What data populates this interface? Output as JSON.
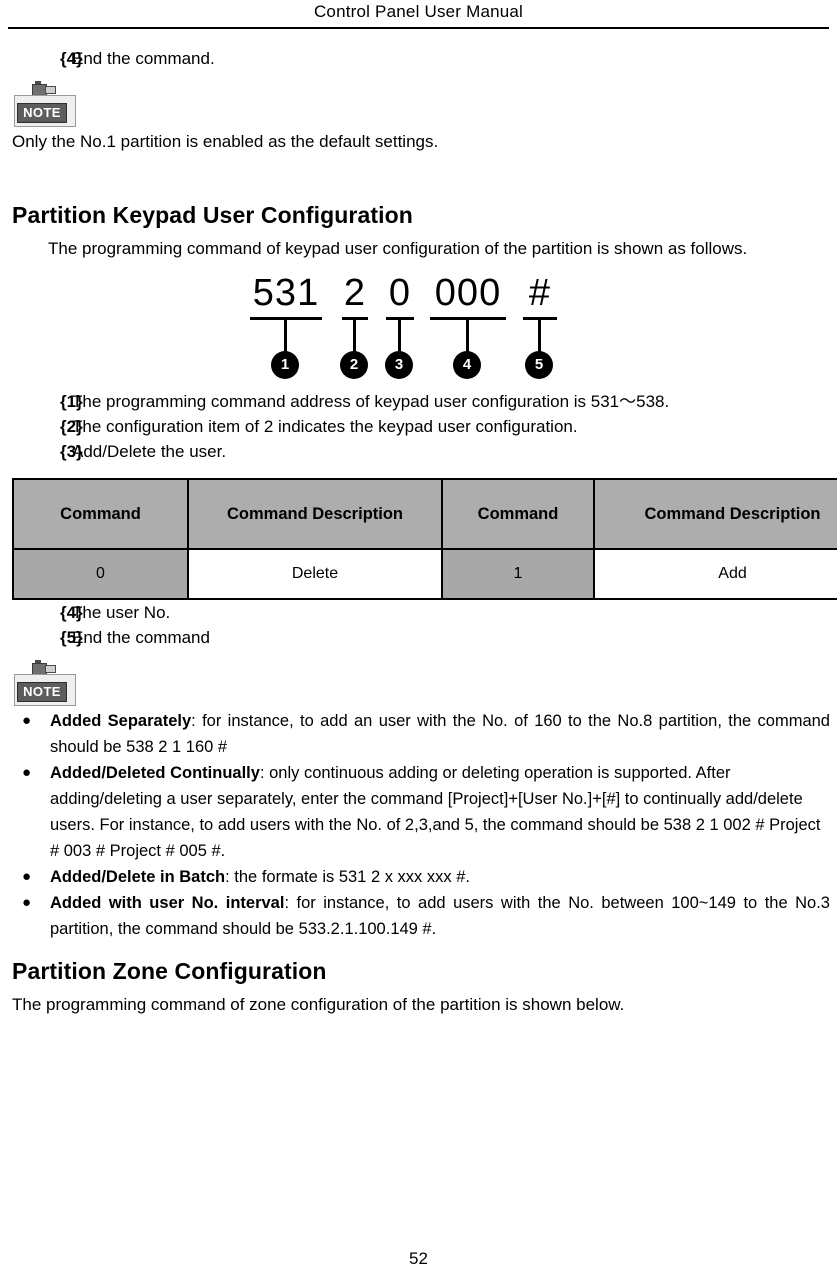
{
  "header": {
    "title": "Control Panel User Manual"
  },
  "footer": {
    "page_number": "52"
  },
  "note_icon": {
    "label": "NOTE"
  },
  "top_section": {
    "item4": {
      "mark": "{4}",
      "text": "End the command."
    },
    "note_text": "Only the No.1 partition is enabled as the default settings."
  },
  "keypad_section": {
    "heading": "Partition Keypad User Configuration",
    "intro": "The programming command of keypad user configuration of the partition is shown as follows.",
    "diagram": {
      "segments": [
        {
          "glyph": "531",
          "badge": "1"
        },
        {
          "glyph": "2",
          "badge": "2"
        },
        {
          "glyph": "0",
          "badge": "3"
        },
        {
          "glyph": "000",
          "badge": "4"
        },
        {
          "glyph": "#",
          "badge": "5"
        }
      ]
    },
    "items": [
      {
        "mark": "{1}",
        "text": "The programming command address of keypad user configuration is 531～538."
      },
      {
        "mark": "{2}",
        "text": "The configuration item of 2 indicates the keypad user configuration."
      },
      {
        "mark": "{3}",
        "text": "Add/Delete the user."
      }
    ],
    "table": {
      "headers": [
        "Command",
        "Command Description",
        "Command",
        "Command Description"
      ],
      "rows": [
        [
          "0",
          "Delete",
          "1",
          "Add"
        ]
      ]
    },
    "items_after_table": [
      {
        "mark": "{4}",
        "text": "The user No."
      },
      {
        "mark": "{5}",
        "text": "End the command"
      }
    ],
    "bullets": [
      {
        "bullet": "●",
        "lead": "Added Separately",
        "body": ": for instance, to add an user with the No. of 160 to the No.8 partition,",
        "line1": ": for instance, to add an user with the No. of 160 to the No.8",
        "line2": "partition, the command should be 538 2 1 160 #",
        "justify": true
      },
      {
        "bullet": "●",
        "lead": "Added/Deleted Continually",
        "line1": ": only continuous adding or deleting operation is",
        "line2": "supported. After adding/deleting a user separately, enter the command",
        "line3": "[Project]+[User No.]+[#] to continually add/delete users. For instance, to add users",
        "line4": "with the No. of 2,3,and 5, the command should be 538 2 1 002 # Project # 003 #",
        "line5": "Project # 005 #.",
        "justify": false
      },
      {
        "bullet": "●",
        "lead": "Added/Delete in Batch",
        "line1": ": the formate is 531 2 x xxx xxx #.",
        "justify": false
      },
      {
        "bullet": "●",
        "lead": "Added with user No. interval",
        "line1": ": for instance, to add users with the No. between",
        "line2": "100~149 to the No.3 partition, the command should be 533.2.1.100.149 #.",
        "justify": true
      }
    ]
  },
  "zone_section": {
    "heading": "Partition Zone Configuration",
    "intro": "The programming command of zone configuration of the partition is shown below."
  },
  "colors": {
    "table_header_gray": "#adadad",
    "table_cell_gray": "#a8a8a8",
    "badge_black": "#000000",
    "text_black": "#000000"
  }
}
